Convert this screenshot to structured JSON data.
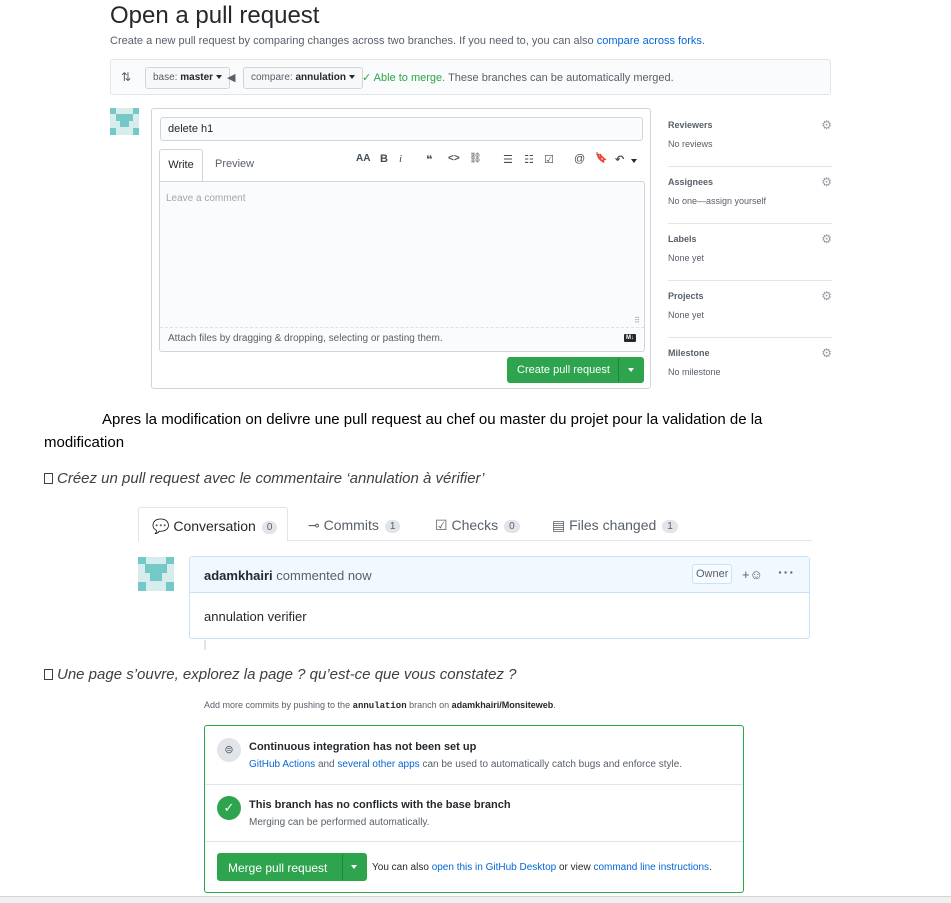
{
  "pr": {
    "title": "Open a pull request",
    "subtitle": "Create a new pull request by comparing changes across two branches. If you need to, you can also",
    "subtitle_link": "compare across forks",
    "subtitle_end": ".",
    "base_label": "base:",
    "base_value": "master",
    "compare_label": "compare:",
    "compare_value": "annulation",
    "able_to_merge": "✓ Able to merge.",
    "merge_hint": "These branches can be automatically merged.",
    "title_input_value": "delete h1",
    "tab_write": "Write",
    "tab_preview": "Preview",
    "comment_placeholder": "Leave a comment",
    "attach_hint": "Attach files by dragging & dropping, selecting or pasting them.",
    "create_button": "Create pull request",
    "toolbar": {
      "heading": "AA",
      "bold": "B",
      "italic": "i",
      "quote": "❝",
      "code": "<>",
      "link": "⛓",
      "bullet_list": "☰",
      "numbered_list": "☷",
      "task_list": "☑",
      "mention": "@",
      "saved_reply": "🔖",
      "reply": "↶"
    }
  },
  "sidebar": [
    {
      "title": "Reviewers",
      "value": "No reviews"
    },
    {
      "title": "Assignees",
      "value": "No one—assign yourself"
    },
    {
      "title": "Labels",
      "value": "None yet"
    },
    {
      "title": "Projects",
      "value": "None yet"
    },
    {
      "title": "Milestone",
      "value": "No milestone"
    }
  ],
  "doc": {
    "para_line1": "Apres la modification on delivre une pull request au chef ou master du projet pour la validation de la",
    "para_line2": "modification",
    "bullet1": "Créez un pull request avec le commentaire ‘annulation à vérifier’",
    "bullet2": "Une page s’ouvre, explorez la page ? qu’est-ce que vous constatez ?"
  },
  "conversation": {
    "tabs": [
      {
        "label": "Conversation",
        "count": "0"
      },
      {
        "label": "Commits",
        "count": "1"
      },
      {
        "label": "Checks",
        "count": "0"
      },
      {
        "label": "Files changed",
        "count": "1"
      }
    ],
    "author": "adamkhairi",
    "time": "commented now",
    "badge": "Owner",
    "body": "annulation verifier"
  },
  "merge": {
    "hint_pre": "Add more commits by pushing to the",
    "hint_branch": "annulation",
    "hint_mid": "branch on",
    "hint_repo": "adamkhairi/Monsiteweb",
    "hint_end": ".",
    "ci_title": "Continuous integration has not been set up",
    "ci_link1": "GitHub Actions",
    "ci_and": "and",
    "ci_link2": "several other apps",
    "ci_desc": "can be used to automatically catch bugs and enforce style.",
    "conflict_title": "This branch has no conflicts with the base branch",
    "conflict_desc": "Merging can be performed automatically.",
    "merge_button": "Merge pull request",
    "alt_pre": "You can also",
    "alt_link1": "open this in GitHub Desktop",
    "alt_mid": "or view",
    "alt_link2": "command line instructions",
    "alt_end": "."
  },
  "colors": {
    "green": "#2ea44f",
    "link": "#0366d6",
    "text": "#24292e",
    "muted": "#586069"
  }
}
